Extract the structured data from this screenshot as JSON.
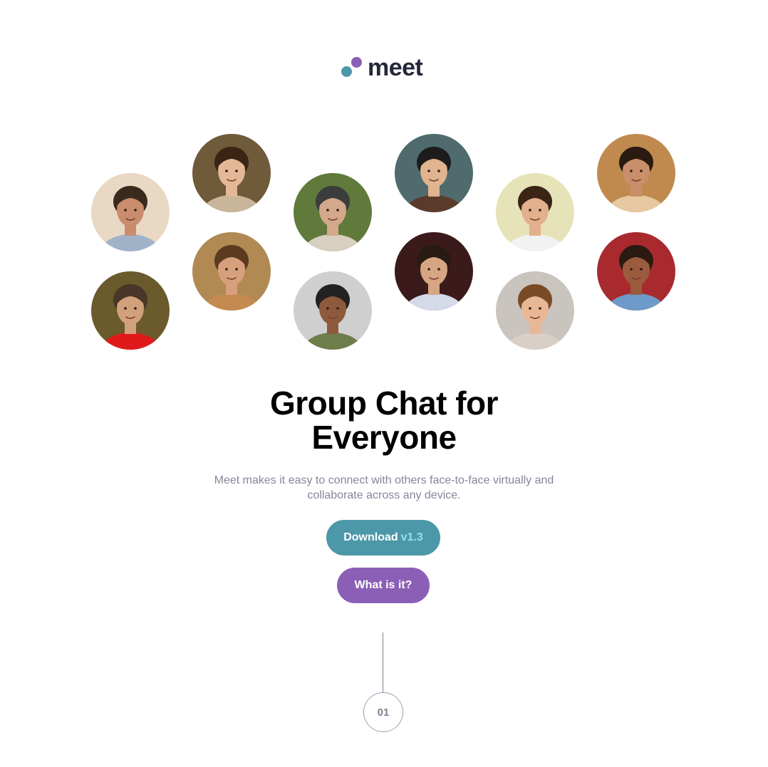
{
  "brand": {
    "name": "meet",
    "colors": {
      "teal": "#4c97a8",
      "purple": "#8c5fb6",
      "dark": "#25283a",
      "accent_light": "#8fe3f0"
    }
  },
  "avatars": [
    {
      "id": "avatar-1",
      "bg": "#e9d8c4",
      "skin": "#c98d6e",
      "hair": "#3a2a1e",
      "shirt": "#9fb2c8"
    },
    {
      "id": "avatar-2",
      "bg": "#6f5a3a",
      "skin": "#e4b896",
      "hair": "#3b2414",
      "shirt": "#c9b59a"
    },
    {
      "id": "avatar-3",
      "bg": "#b08a52",
      "skin": "#d7a07c",
      "hair": "#5b3a20",
      "shirt": "#c48a50"
    },
    {
      "id": "avatar-4",
      "bg": "#5f7a3a",
      "skin": "#d4a88a",
      "hair": "#3c3c3c",
      "shirt": "#d9cfc0"
    },
    {
      "id": "avatar-5",
      "bg": "#cfcfcf",
      "skin": "#8e5a3c",
      "hair": "#222222",
      "shirt": "#6e7d4a"
    },
    {
      "id": "avatar-6",
      "bg": "#4f6b6e",
      "skin": "#e0b48e",
      "hair": "#1c1c1c",
      "shirt": "#5a3b2a"
    },
    {
      "id": "avatar-7",
      "bg": "#3a1a1a",
      "skin": "#d8a583",
      "hair": "#2a1a14",
      "shirt": "#d4dae8"
    },
    {
      "id": "avatar-8",
      "bg": "#e6e3b8",
      "skin": "#e2b08c",
      "hair": "#3a2416",
      "shirt": "#f2f2f2"
    },
    {
      "id": "avatar-9",
      "bg": "#c9c4be",
      "skin": "#e8b896",
      "hair": "#7a4a26",
      "shirt": "#d8d0c8"
    },
    {
      "id": "avatar-10",
      "bg": "#c08a4e",
      "skin": "#c98f6a",
      "hair": "#2a1a10",
      "shirt": "#e6c9a0"
    },
    {
      "id": "avatar-11",
      "bg": "#a82a2e",
      "skin": "#9a5c3c",
      "hair": "#2b1a10",
      "shirt": "#6d9ac8"
    },
    {
      "id": "avatar-12",
      "bg": "#6a5a2c",
      "skin": "#d2a07a",
      "hair": "#4a3628",
      "shirt": "#e01a1a"
    }
  ],
  "hero": {
    "title_line1": "Group Chat for",
    "title_line2": "Everyone",
    "subtitle_line1": "Meet makes it easy to connect with others face-to-face virtually and",
    "subtitle_line2": "collaborate across any device."
  },
  "buttons": {
    "download_label": "Download",
    "download_version": "v1.3",
    "what_label": "What is it?"
  },
  "step": {
    "number": "01"
  }
}
